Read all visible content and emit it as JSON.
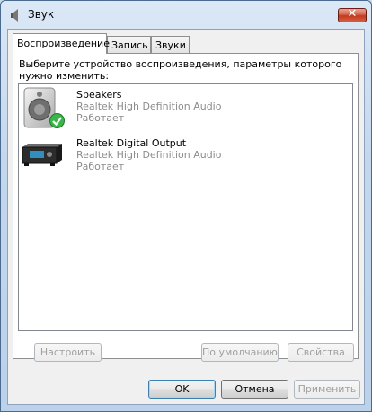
{
  "window": {
    "title": "Звук"
  },
  "tabs": [
    {
      "label": "Воспроизведение",
      "active": true
    },
    {
      "label": "Запись",
      "active": false
    },
    {
      "label": "Звуки",
      "active": false
    }
  ],
  "instruction": "Выберите устройство воспроизведения, параметры которого нужно изменить:",
  "devices": [
    {
      "name": "Speakers",
      "driver": "Realtek High Definition Audio",
      "status": "Работает",
      "icon": "speaker-icon",
      "default": true
    },
    {
      "name": "Realtek Digital Output",
      "driver": "Realtek High Definition Audio",
      "status": "Работает",
      "icon": "digital-output-icon",
      "default": false
    }
  ],
  "panel_buttons": {
    "configure": "Настроить",
    "set_default": "По умолчанию",
    "properties": "Свойства"
  },
  "dialog_buttons": {
    "ok": "OK",
    "cancel": "Отмена",
    "apply": "Применить"
  },
  "colors": {
    "close_button": "#c13a20",
    "default_check": "#3bb54a"
  }
}
